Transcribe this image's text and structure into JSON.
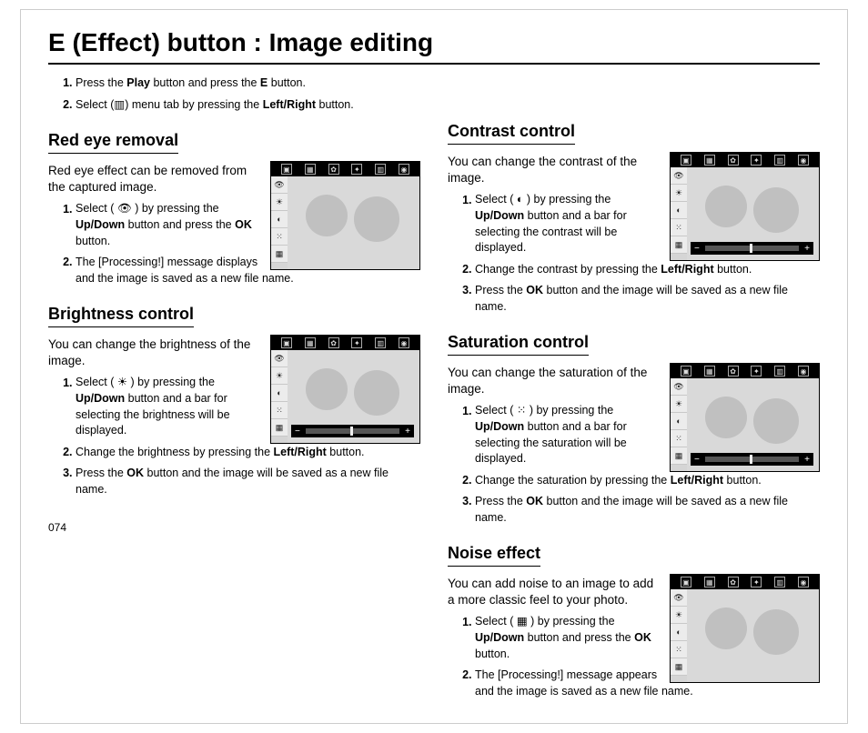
{
  "pageNumber": "074",
  "title": "E (Effect) button : Image editing",
  "intro": {
    "step1_a": "Press the ",
    "step1_play": "Play",
    "step1_b": " button and press the ",
    "step1_e": "E",
    "step1_c": " button.",
    "step2_a": "Select (",
    "step2_b": ") menu tab by pressing the ",
    "step2_lr": "Left/Right",
    "step2_c": " button."
  },
  "icons": {
    "menuTab": "▥",
    "eye": "👁",
    "sun": "☀",
    "halfCircle": "◐",
    "dots": "⁙",
    "noise": "▦"
  },
  "redEye": {
    "heading": "Red eye removal",
    "lead": "Red eye effect can be removed from the captured image.",
    "step1_a": "Select ( ",
    "step1_b": " ) by pressing the ",
    "step1_ud": "Up/Down",
    "step1_c": " button and press the ",
    "step1_ok": "OK",
    "step1_d": " button.",
    "step2_num": "2",
    "step2": "The [Processing!] message displays and the image is saved as a new file name."
  },
  "brightness": {
    "heading": "Brightness control",
    "lead": "You can change the brightness of the image.",
    "step1_a": "Select ( ",
    "step1_b": " ) by pressing the ",
    "step1_ud": "Up/Down",
    "step1_c": " button and a bar for selecting the brightness will be displayed.",
    "step2_a": "Change the brightness by pressing the ",
    "step2_lr": "Left/Right",
    "step2_b": " button.",
    "step3_a": "Press the ",
    "step3_ok": "OK",
    "step3_b": " button and the image will be saved as a new file name."
  },
  "contrast": {
    "heading": "Contrast control",
    "lead": "You can change the contrast of the image.",
    "step1_a": "Select ( ",
    "step1_b": " ) by pressing the ",
    "step1_ud": "Up/Down",
    "step1_c": " button and a bar for selecting the contrast will be displayed.",
    "step2_a": "Change the contrast by pressing the ",
    "step2_lr": "Left/Right",
    "step2_b": " button.",
    "step3_a": "Press the ",
    "step3_ok": "OK",
    "step3_b": " button and the image will be saved as a new file name."
  },
  "saturation": {
    "heading": "Saturation control",
    "lead": "You can change the saturation of the image.",
    "step1_a": "Select ( ",
    "step1_b": " ) by pressing the ",
    "step1_ud": "Up/Down",
    "step1_c": " button and a bar for selecting the saturation will be displayed.",
    "step2_a": "Change the saturation by pressing the ",
    "step2_lr": "Left/Right",
    "step2_b": " button.",
    "step3_a": "Press the ",
    "step3_ok": "OK",
    "step3_b": " button and the image will be saved as a new file name."
  },
  "noise": {
    "heading": "Noise effect",
    "lead": "You can add noise to an image to add a more classic feel to your photo.",
    "step1_a": "Select ( ",
    "step1_b": " ) by pressing the ",
    "step1_ud": "Up/Down",
    "step1_c": " button and press the ",
    "step1_ok": "OK",
    "step1_d": " button.",
    "step2": "The [Processing!] message appears and the image is saved as a new file name."
  }
}
